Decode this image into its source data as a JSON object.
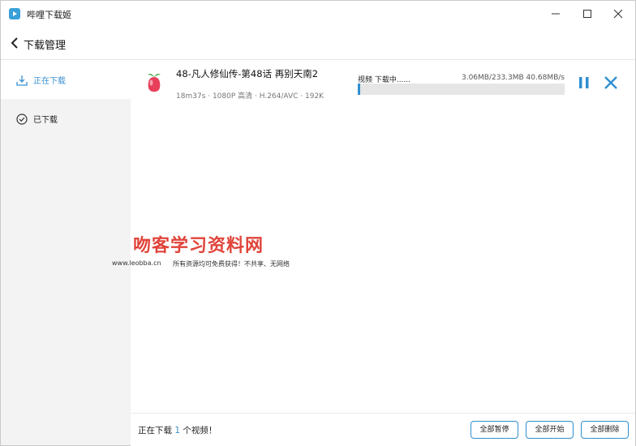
{
  "app": {
    "title": "哔哩下载姬"
  },
  "header": {
    "title": "下载管理"
  },
  "sidebar": {
    "items": [
      {
        "label": "正在下载",
        "icon": "download-icon",
        "active": true
      },
      {
        "label": "已下载",
        "icon": "check-circle-icon",
        "active": false
      }
    ]
  },
  "download": {
    "title": "48-凡人修仙传-第48话 再别天南2",
    "meta": "18m37s · 1080P 高清 · H.264/AVC · 192K",
    "status": "视频 下载中......",
    "speed": "3.06MB/233.3MB 40.68MB/s",
    "progress": 0.013
  },
  "watermark": {
    "title": "吻客学习资料网",
    "site": "www.leobba.cn",
    "note": "所有资源均可免费获得！不共享、无网络"
  },
  "footer": {
    "prefix": "正在下载 ",
    "count": "1",
    "suffix": " 个视频！",
    "buttons": {
      "pause_all": "全部暂停",
      "start_all": "全部开始",
      "delete_all": "全部删除"
    }
  },
  "colors": {
    "accent": "#2f8fd0",
    "watermark": "#e0443a"
  }
}
